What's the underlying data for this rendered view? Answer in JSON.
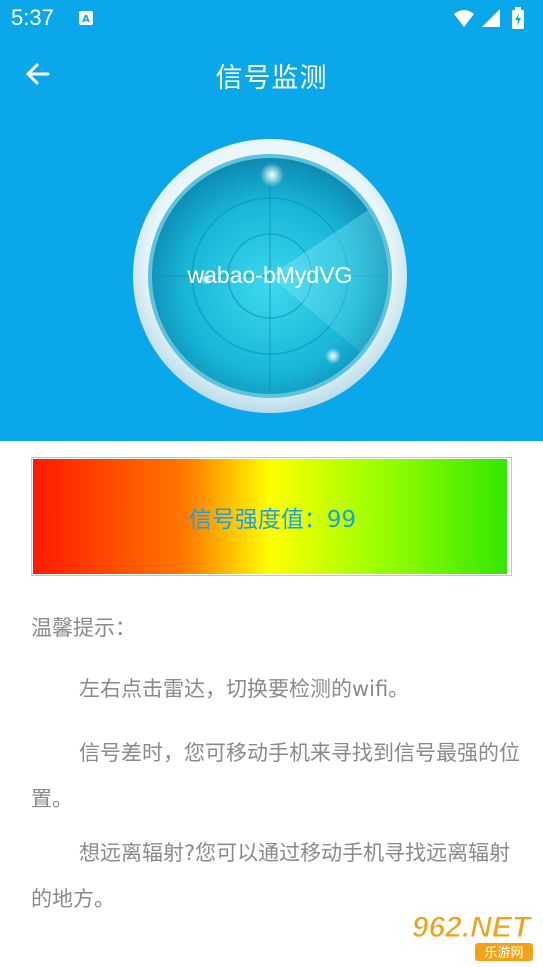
{
  "status_bar": {
    "time": "5:37",
    "icons": [
      "notification-a-icon",
      "wifi-icon",
      "signal-icon",
      "battery-icon"
    ]
  },
  "app_bar": {
    "title": "信号监测",
    "back_icon": "arrow-left-icon"
  },
  "radar": {
    "ssid": "wabao-bMydVG",
    "colors": {
      "ring": "#e8f7fc",
      "face": "#1fc6e2",
      "face_dark": "#0a8fb6"
    }
  },
  "strength": {
    "label": "信号强度值：99",
    "value": 99
  },
  "tips": {
    "title": "温馨提示：",
    "items": [
      "左右点击雷达，切换要检测的wifi。",
      "信号差时，您可移动手机来寻找到信号最强的位置。",
      "想远离辐射?您可以通过移动手机寻找远离辐射的地方。"
    ]
  },
  "watermark": {
    "text": "962.NET",
    "subtext": "乐游网"
  },
  "colors": {
    "header_bg": "#0aa8ea",
    "tip_text": "#8a8a8a",
    "value_text": "#1aa0e6"
  }
}
